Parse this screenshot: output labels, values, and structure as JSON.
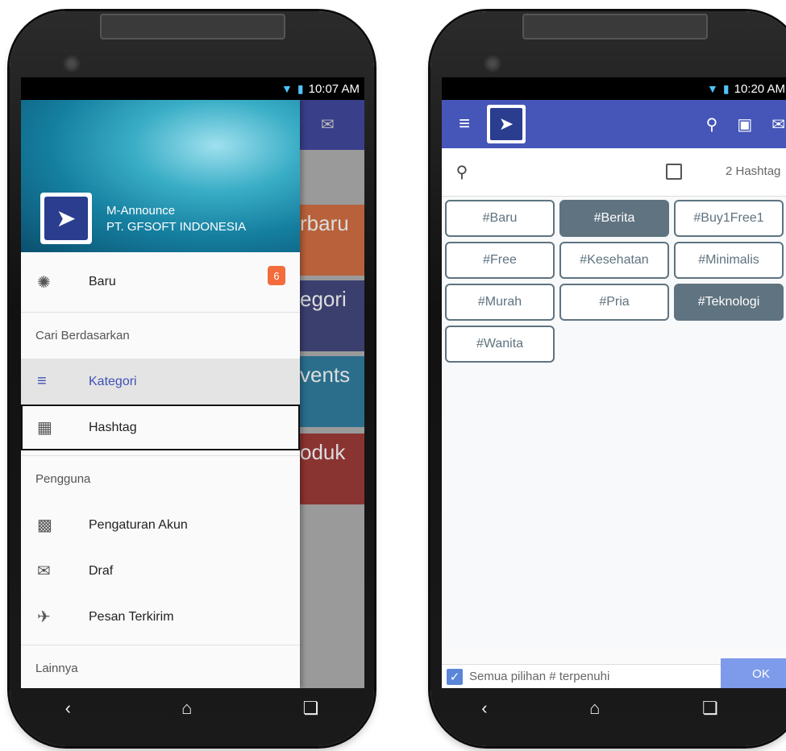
{
  "left": {
    "status": {
      "time": "10:07 AM"
    },
    "background_tiles": [
      "rbaru",
      "egori",
      "vents",
      "oduk"
    ],
    "background_colors": [
      "#e3703e",
      "#3a3f8a",
      "#1e7fa8",
      "#c8332a"
    ],
    "header": {
      "app_name": "M-Announce",
      "company": "PT. GFSOFT INDONESIA"
    },
    "baru": {
      "label": "Baru",
      "badge": "6",
      "icon": "new-badge-icon"
    },
    "section_cari": "Cari Berdasarkan",
    "kategori": {
      "label": "Kategori",
      "icon": "list-icon"
    },
    "hashtag": {
      "label": "Hashtag",
      "icon": "hashtag-icon"
    },
    "section_pengguna": "Pengguna",
    "akun": {
      "label": "Pengaturan Akun",
      "icon": "account-icon"
    },
    "draf": {
      "label": "Draf",
      "icon": "draft-mail-icon"
    },
    "terkirim": {
      "label": "Pesan Terkirim",
      "icon": "sent-mail-icon"
    },
    "section_lainnya": "Lainnya"
  },
  "right": {
    "status": {
      "time": "10:20 AM"
    },
    "search": {
      "count_label": "2 Hashtag"
    },
    "tags": [
      {
        "label": "#Baru",
        "selected": false
      },
      {
        "label": "#Berita",
        "selected": true
      },
      {
        "label": "#Buy1Free1",
        "selected": false
      },
      {
        "label": "#Free",
        "selected": false
      },
      {
        "label": "#Kesehatan",
        "selected": false
      },
      {
        "label": "#Minimalis",
        "selected": false
      },
      {
        "label": "#Murah",
        "selected": false
      },
      {
        "label": "#Pria",
        "selected": false
      },
      {
        "label": "#Teknologi",
        "selected": true
      },
      {
        "label": "#Wanita",
        "selected": false
      }
    ],
    "footer": {
      "match_all_label": "Semua pilihan # terpenuhi",
      "match_all_checked": true,
      "ok_label": "OK"
    }
  },
  "colors": {
    "toolbar": "#4556b8",
    "tag_border": "#5f7380",
    "badge": "#f36c3d",
    "ok_button": "#7d9bea"
  }
}
